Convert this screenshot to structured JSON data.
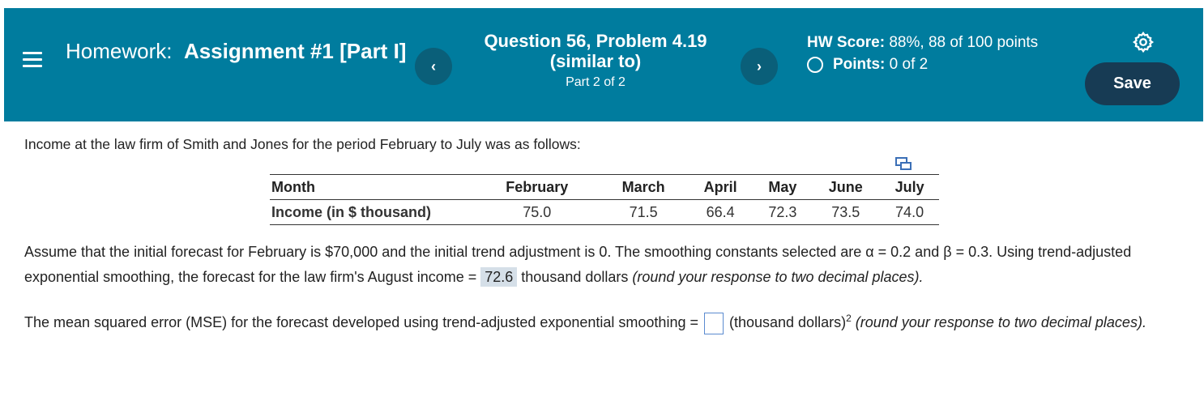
{
  "header": {
    "homework_prefix": "Homework:",
    "assignment_name": "Assignment #1 [Part I]",
    "question_title": "Question 56, Problem 4.19 (similar to)",
    "question_part": "Part 2 of 2",
    "prev_symbol": "‹",
    "next_symbol": "›",
    "hw_score_label": "HW Score:",
    "hw_score_value": "88%, 88 of 100 points",
    "points_label": "Points:",
    "points_value": "0 of 2",
    "save_label": "Save"
  },
  "problem": {
    "intro": "Income at the law firm of Smith and Jones for the period February to July was as follows:",
    "table": {
      "header_label": "Month",
      "months": [
        "February",
        "March",
        "April",
        "May",
        "June",
        "July"
      ],
      "row_label": "Income (in $ thousand)",
      "values": [
        "75.0",
        "71.5",
        "66.4",
        "72.3",
        "73.5",
        "74.0"
      ]
    },
    "para1_part1": "Assume that the initial forecast for February is $70,000 and the initial trend adjustment is 0. The smoothing constants selected are α = 0.2 and β = 0.3. Using trend-adjusted exponential smoothing, the forecast for the law firm's August income = ",
    "forecast_answer": "72.6",
    "para1_part2": " thousand dollars ",
    "para1_italic": "(round your response to two decimal places).",
    "para2_part1": "The mean squared error (MSE) for the forecast developed using trend-adjusted exponential smoothing = ",
    "mse_answer": "",
    "para2_units": " (thousand dollars)",
    "para2_sup": "2",
    "para2_italic": " (round your response to two decimal places)."
  },
  "colors": {
    "header_bg": "#007c9e",
    "nav_btn": "#0a5f79",
    "save_btn": "#173b54",
    "answer_highlight": "#d5dfe8"
  },
  "icons": [
    "menu-icon",
    "chevron-left-icon",
    "chevron-right-icon",
    "circle-icon",
    "gear-icon",
    "copy-table-icon"
  ]
}
